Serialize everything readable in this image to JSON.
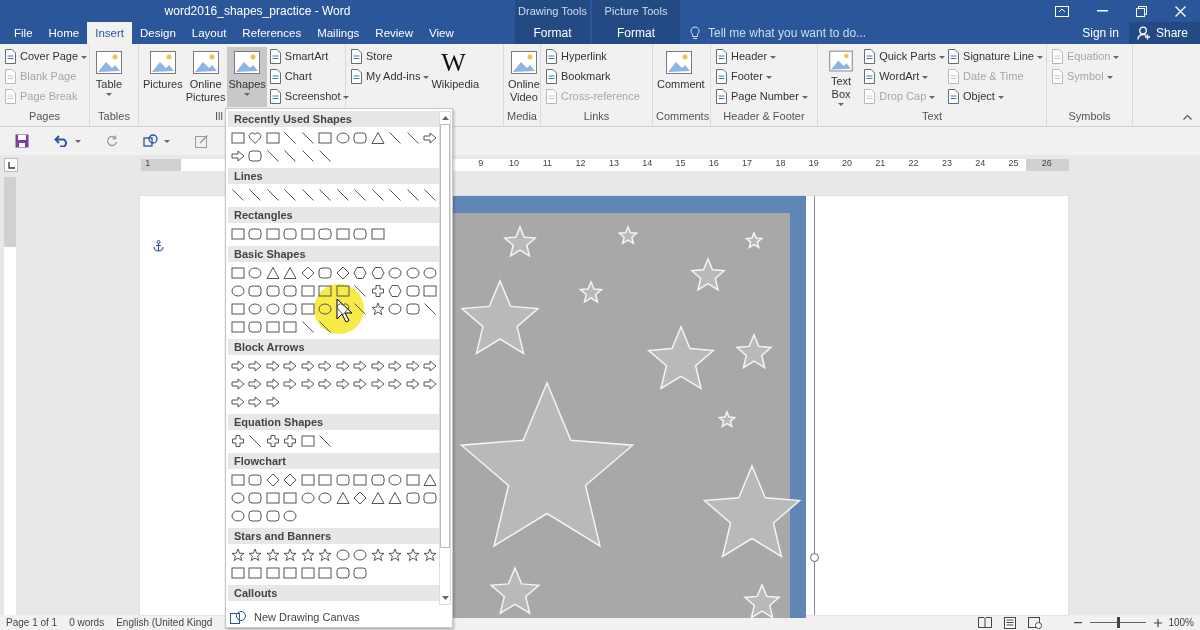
{
  "window": {
    "title": "word2016_shapes_practice - Word"
  },
  "tabs": [
    {
      "label": "File",
      "selected": false
    },
    {
      "label": "Home",
      "selected": false
    },
    {
      "label": "Insert",
      "selected": true
    },
    {
      "label": "Design",
      "selected": false
    },
    {
      "label": "Layout",
      "selected": false
    },
    {
      "label": "References",
      "selected": false
    },
    {
      "label": "Mailings",
      "selected": false
    },
    {
      "label": "Review",
      "selected": false
    },
    {
      "label": "View",
      "selected": false
    }
  ],
  "context_tabs": [
    {
      "group": "Drawing Tools",
      "label": "Format",
      "selected": false
    },
    {
      "group": "Picture Tools",
      "label": "Format",
      "selected": false
    }
  ],
  "tell_me": {
    "placeholder": "Tell me what you want to do..."
  },
  "account": {
    "sign_in": "Sign in",
    "share": "Share"
  },
  "ribbon": [
    {
      "label": "Pages",
      "columns": [
        [
          {
            "kind": "small",
            "label": "Cover Page",
            "dropdown": true,
            "disabled": false
          },
          {
            "kind": "small",
            "label": "Blank Page",
            "dropdown": false,
            "disabled": true
          },
          {
            "kind": "small",
            "label": "Page Break",
            "dropdown": false,
            "disabled": true
          }
        ]
      ]
    },
    {
      "label": "Tables",
      "columns": [
        [
          {
            "kind": "large",
            "label": "Table",
            "dropdown": true,
            "disabled": false,
            "selected": false
          }
        ]
      ]
    },
    {
      "label": "Ill",
      "columns": [
        [
          {
            "kind": "large",
            "label": "Pictures",
            "dropdown": false,
            "disabled": false,
            "selected": false
          }
        ],
        [
          {
            "kind": "large",
            "label": "Online Pictures",
            "dropdown": false,
            "disabled": false,
            "selected": false
          }
        ],
        [
          {
            "kind": "large",
            "label": "Shapes",
            "dropdown": true,
            "disabled": false,
            "selected": true
          }
        ],
        [
          {
            "kind": "small",
            "label": "SmartArt",
            "dropdown": false,
            "disabled": false
          },
          {
            "kind": "small",
            "label": "Chart",
            "dropdown": false,
            "disabled": false
          },
          {
            "kind": "small",
            "label": "Screenshot",
            "dropdown": true,
            "disabled": false
          }
        ]
      ]
    },
    {
      "columns": [
        [
          {
            "kind": "small",
            "label": "Store",
            "dropdown": false,
            "disabled": false
          },
          {
            "kind": "small",
            "label": "My Add-ins",
            "dropdown": true,
            "disabled": false
          }
        ],
        [
          {
            "kind": "large",
            "label": "Wikipedia",
            "glyph": "W",
            "dropdown": false,
            "disabled": false,
            "selected": false
          }
        ]
      ]
    },
    {
      "label": "Media",
      "columns": [
        [
          {
            "kind": "large",
            "label": "Online Video",
            "dropdown": false,
            "disabled": false,
            "selected": false
          }
        ]
      ]
    },
    {
      "label": "Links",
      "columns": [
        [
          {
            "kind": "small",
            "label": "Hyperlink",
            "dropdown": false,
            "disabled": false
          },
          {
            "kind": "small",
            "label": "Bookmark",
            "dropdown": false,
            "disabled": false
          },
          {
            "kind": "small",
            "label": "Cross-reference",
            "dropdown": false,
            "disabled": true
          }
        ]
      ]
    },
    {
      "label": "Comments",
      "columns": [
        [
          {
            "kind": "large",
            "label": "Comment",
            "dropdown": false,
            "disabled": false,
            "selected": false
          }
        ]
      ]
    },
    {
      "label": "Header & Footer",
      "columns": [
        [
          {
            "kind": "small",
            "label": "Header",
            "dropdown": true,
            "disabled": false
          },
          {
            "kind": "small",
            "label": "Footer",
            "dropdown": true,
            "disabled": false
          },
          {
            "kind": "small",
            "label": "Page Number",
            "dropdown": true,
            "disabled": false
          }
        ]
      ]
    },
    {
      "label": "Text",
      "columns": [
        [
          {
            "kind": "large",
            "label": "Text Box",
            "dropdown": true,
            "disabled": false,
            "selected": false
          }
        ],
        [
          {
            "kind": "small",
            "label": "Quick Parts",
            "dropdown": true,
            "disabled": false
          },
          {
            "kind": "small",
            "label": "WordArt",
            "dropdown": true,
            "disabled": false
          },
          {
            "kind": "small",
            "label": "Drop Cap",
            "dropdown": true,
            "disabled": true
          }
        ],
        [
          {
            "kind": "small",
            "label": "Signature Line",
            "dropdown": true,
            "disabled": false
          },
          {
            "kind": "small",
            "label": "Date & Time",
            "dropdown": false,
            "disabled": true
          },
          {
            "kind": "small",
            "label": "Object",
            "dropdown": true,
            "disabled": false
          }
        ]
      ]
    },
    {
      "label": "Symbols",
      "columns": [
        [
          {
            "kind": "small",
            "label": "Equation",
            "dropdown": true,
            "disabled": true
          },
          {
            "kind": "small",
            "label": "Symbol",
            "dropdown": true,
            "disabled": true
          }
        ]
      ]
    }
  ],
  "ruler": {
    "left_labels": [
      "1"
    ],
    "labels": [
      "9",
      "10",
      "11",
      "12",
      "13",
      "14",
      "15",
      "16",
      "17",
      "18",
      "19",
      "20",
      "21",
      "22",
      "23",
      "24",
      "25",
      "26"
    ]
  },
  "shapes_gallery": {
    "sections": [
      {
        "title": "Recently Used Shapes"
      },
      {
        "title": "Lines"
      },
      {
        "title": "Rectangles"
      },
      {
        "title": "Basic Shapes"
      },
      {
        "title": "Block Arrows"
      },
      {
        "title": "Equation Shapes"
      },
      {
        "title": "Flowchart"
      },
      {
        "title": "Stars and Banners"
      },
      {
        "title": "Callouts"
      }
    ],
    "footer": "New Drawing Canvas"
  },
  "status_bar": {
    "page": "Page 1 of 1",
    "words": "0 words",
    "language": "English (United Kingd",
    "zoom": {
      "level": 0.5,
      "reading": "100%"
    }
  }
}
